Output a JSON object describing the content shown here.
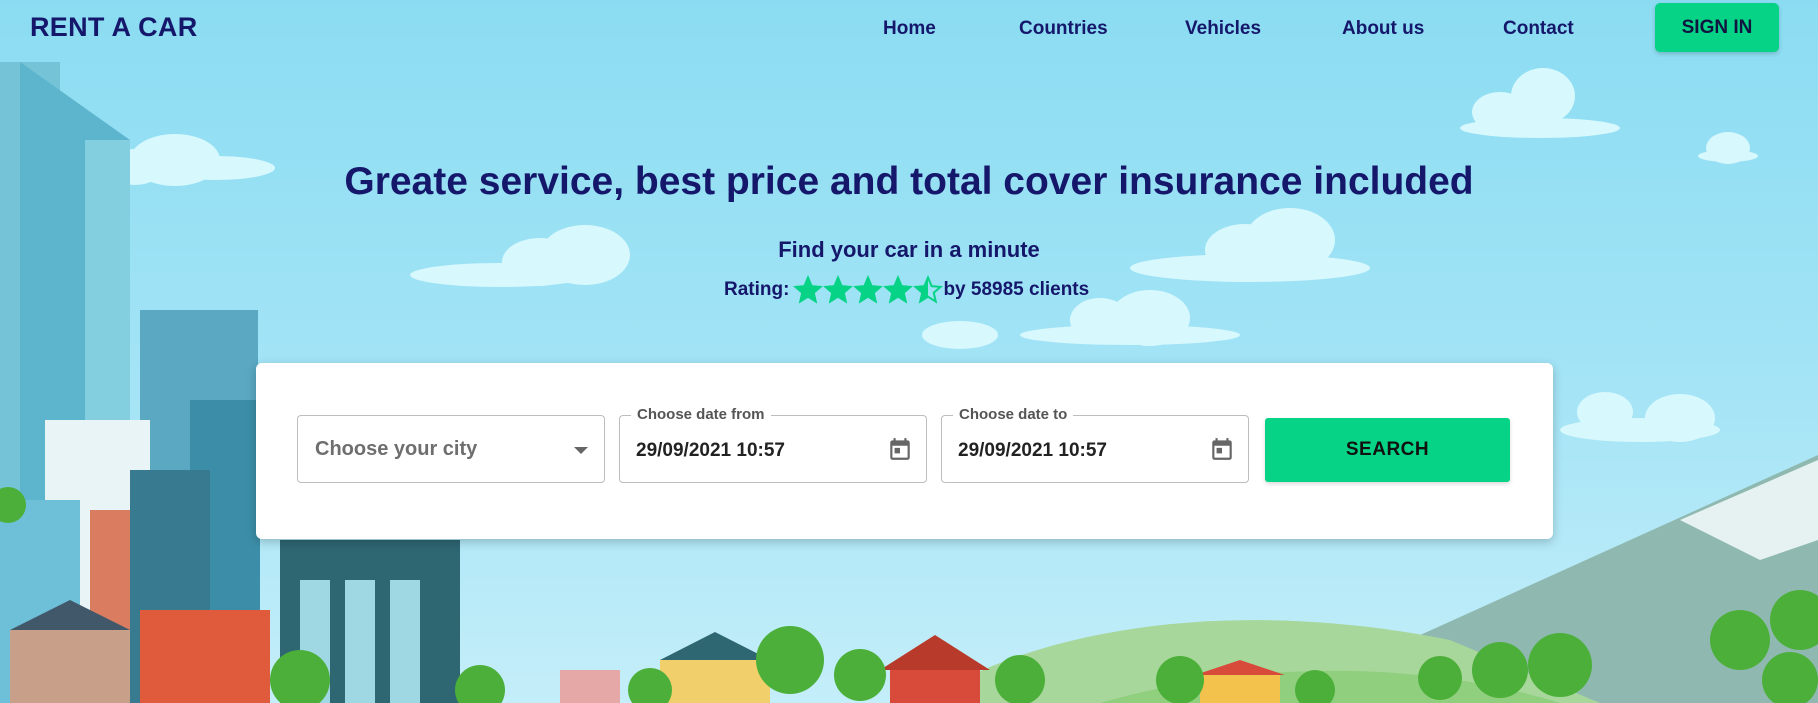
{
  "brand": {
    "logo": "RENT A CAR",
    "accent_color": "#06d386",
    "text_color": "#15176b"
  },
  "nav": {
    "items": [
      {
        "label": "Home"
      },
      {
        "label": "Countries"
      },
      {
        "label": "Vehicles"
      },
      {
        "label": "About us"
      },
      {
        "label": "Contact"
      }
    ],
    "signin_label": "SIGN IN"
  },
  "hero": {
    "title": "Greate service, best price and total cover insurance included",
    "subtitle": "Find your car in a minute",
    "rating": {
      "label": "Rating:",
      "stars": 4.5,
      "max": 5,
      "suffix": "by 58985 clients",
      "icon": "star-icon"
    }
  },
  "search": {
    "city": {
      "placeholder": "Choose your city",
      "icon": "chevron-down-icon"
    },
    "date_from": {
      "label": "Choose date from",
      "value": "29/09/2021 10:57",
      "icon": "calendar-icon"
    },
    "date_to": {
      "label": "Choose date to",
      "value": "29/09/2021 10:57",
      "icon": "calendar-icon"
    },
    "button_label": "SEARCH"
  }
}
